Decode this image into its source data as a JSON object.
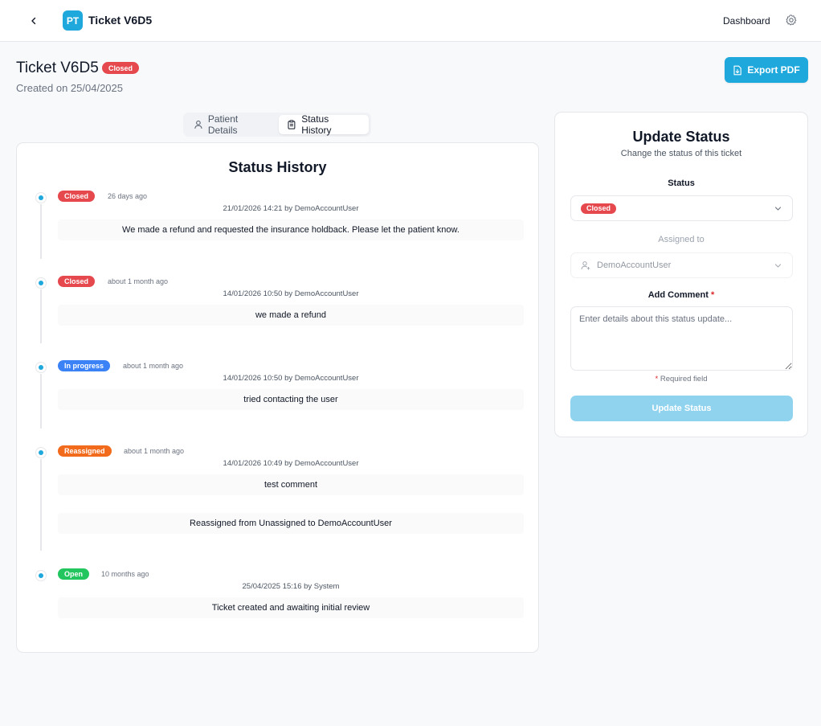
{
  "topbar": {
    "logo_text": "PT",
    "app_title": "Ticket V6D5",
    "nav_dashboard": "Dashboard"
  },
  "header": {
    "title": "Ticket V6D5",
    "status_badge": "Closed",
    "created_on": "Created on 25/04/2025",
    "export_label": "Export PDF"
  },
  "tabs": [
    {
      "label": "Patient Details",
      "icon": "user-icon",
      "active": false
    },
    {
      "label": "Status History",
      "icon": "clipboard-icon",
      "active": true
    }
  ],
  "history": {
    "title": "Status History",
    "entries": [
      {
        "badge": "Closed",
        "badge_color": "#e5484d",
        "ago": "26 days ago",
        "meta": "21/01/2026 14:21 by DemoAccountUser",
        "messages": [
          "We made a refund and requested the insurance holdback. Please let the patient know."
        ]
      },
      {
        "badge": "Closed",
        "badge_color": "#e5484d",
        "ago": "about 1 month ago",
        "meta": "14/01/2026 10:50 by DemoAccountUser",
        "messages": [
          "we made a refund"
        ]
      },
      {
        "badge": "In progress",
        "badge_color": "#3b82f6",
        "ago": "about 1 month ago",
        "meta": "14/01/2026 10:50 by DemoAccountUser",
        "messages": [
          "tried contacting the user"
        ]
      },
      {
        "badge": "Reassigned",
        "badge_color": "#f26b1d",
        "ago": "about 1 month ago",
        "meta": "14/01/2026 10:49 by DemoAccountUser",
        "messages": [
          "test comment",
          "Reassigned from Unassigned to DemoAccountUser"
        ]
      },
      {
        "badge": "Open",
        "badge_color": "#22c55e",
        "ago": "10 months ago",
        "meta": "25/04/2025 15:16 by System",
        "messages": [
          "Ticket created and awaiting initial review"
        ]
      }
    ]
  },
  "update": {
    "title": "Update Status",
    "subtitle": "Change the status of this ticket",
    "status_label": "Status",
    "status_value": "Closed",
    "assigned_label": "Assigned to",
    "assigned_value": "DemoAccountUser",
    "comment_label": "Add Comment",
    "comment_required": "*",
    "comment_placeholder": "Enter details about this status update...",
    "required_star": "*",
    "required_note": "Required field",
    "submit_label": "Update Status"
  },
  "colors": {
    "accent": "#1fa8dc",
    "closed": "#e5484d",
    "in_progress": "#3b82f6",
    "reassigned": "#f26b1d",
    "open": "#22c55e",
    "submit_disabled": "#90d3ef"
  }
}
